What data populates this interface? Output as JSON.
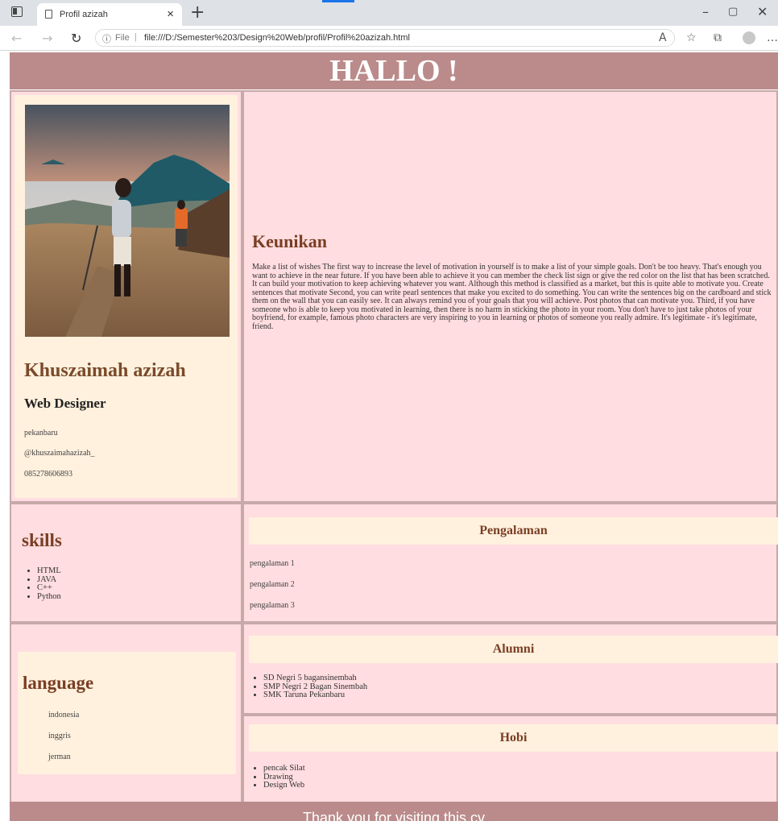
{
  "browser": {
    "tab_title": "Profil azizah",
    "close_glyph": "×",
    "new_tab_glyph": "+",
    "address_prefix": "File",
    "url": "file:///D:/Semester%203/Design%20Web/profil/Profil%20azizah.html",
    "icons": [
      "back-icon",
      "forward-icon",
      "refresh-icon",
      "info-icon",
      "read-aloud-icon",
      "favorites-icon",
      "collections-icon",
      "profile-icon",
      "more-icon"
    ]
  },
  "header": {
    "title": "HALLO !"
  },
  "profile": {
    "name": "Khuszaimah azizah",
    "role": "Web Designer",
    "city": "pekanbaru",
    "instagram": "@khuszaimahazizah_",
    "phone": "085278606893"
  },
  "keunikan": {
    "title": "Keunikan",
    "text": "Make a list of wishes The first way to increase the level of motivation in yourself is to make a list of your simple goals. Don't be too heavy. That's enough you want to achieve in the near future. If you have been able to achieve it you can member the check list sign or give the red color on the list that has been scratched. It can build your motivation to keep achieving whatever you want. Although this method is classified as a market, but this is quite able to motivate you. Create sentences that motivate Second, you can write pearl sentences that make you excited to do something. You can write the sentences big on the cardboard and stick them on the wall that you can easily see. It can always remind you of your goals that you will achieve. Post photos that can motivate you. Third, if you have someone who is able to keep you motivated in learning, then there is no harm in sticking the photo in your room. You don't have to just take photos of your boyfriend, for example, famous photo characters are very inspiring to you in learning or photos of someone you really admire. It's legitimate - it's legitimate, friend."
  },
  "skills": {
    "title": "skills",
    "items": [
      "HTML",
      "JAVA",
      "C++",
      "Python"
    ]
  },
  "pengalaman": {
    "title": "Pengalaman",
    "items": [
      "pengalaman 1",
      "pengalaman 2",
      "pengalaman 3"
    ]
  },
  "language": {
    "title": "language",
    "items": [
      "indonesia",
      "inggris",
      "jerman"
    ]
  },
  "alumni": {
    "title": "Alumni",
    "items": [
      "SD Negri 5 bagansinembah",
      "SMP Negri 2 Bagan Sinembah",
      "SMK Taruna Pekanbaru"
    ]
  },
  "hobi": {
    "title": "Hobi",
    "items": [
      "pencak Silat",
      "Drawing",
      "Design Web"
    ]
  },
  "footer": {
    "text": "Thank you for visiting this cv"
  }
}
